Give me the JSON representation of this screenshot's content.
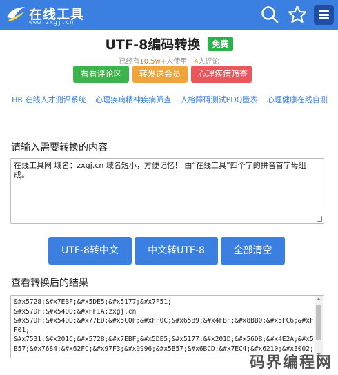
{
  "brand": {
    "name": "在线工具",
    "domain": "www.zxgj.cn"
  },
  "header": {
    "title": "UTF-8编码转换",
    "badge": "免费",
    "stats_prefix": "已经有",
    "users_count": "10.5w+",
    "users_suffix": "人使用",
    "reviews_count": "4",
    "reviews_suffix": "人评论"
  },
  "actions": [
    {
      "label": "看看评论区",
      "color": "#3cb44b"
    },
    {
      "label": "转发送会员",
      "color": "#f0a43c"
    },
    {
      "label": "心理疾病筛查",
      "color": "#e9575b"
    }
  ],
  "related_links": [
    "HR 在线人才测评系统",
    "心理疾病精神疾病筛查",
    "人格障碍测试PDQ量表",
    "心理健康在线自测"
  ],
  "input_section": {
    "label": "请输入需要转换的内容",
    "value": "在线工具网    域名：zxgj.cn    域名短小，方便记忆！ 由“在线工具”四个字的拼音首字母组成。"
  },
  "buttons": {
    "to_chinese": "UTF-8转中文",
    "to_utf8": "中文转UTF-8",
    "clear": "全部清空"
  },
  "output_section": {
    "label": "查看转换后的结果",
    "value": "&#x5728;&#x7EBF;&#x5DE5;&#x5177;&#x7F51;\n&#x57DF;&#x540D;&#xFF1A;zxgj.cn\n&#x57DF;&#x540D;&#x77ED;&#x5C0F;&#xFF0C;&#x65B9;&#x4FBF;&#x8BB0;&#x5FC6;&#xFF01;\n&#x7531;&#x201C;&#x5728;&#x7EBF;&#x5DE5;&#x5177;&#x201D;&#x56DB;&#x4E2A;&#x5B57;&#x7684;&#x62FC;&#x97F3;&#x9996;&#x5B57;&#x6BCD;&#x7EC4;&#x6210;&#x3002;"
  },
  "watermark": "码界编程网",
  "colors": {
    "topbar": "#3b7fe0",
    "primary_button": "#3b7fe0",
    "badge": "#27b24a",
    "highlight": "#e07a1f",
    "link": "#3b7fe0"
  }
}
